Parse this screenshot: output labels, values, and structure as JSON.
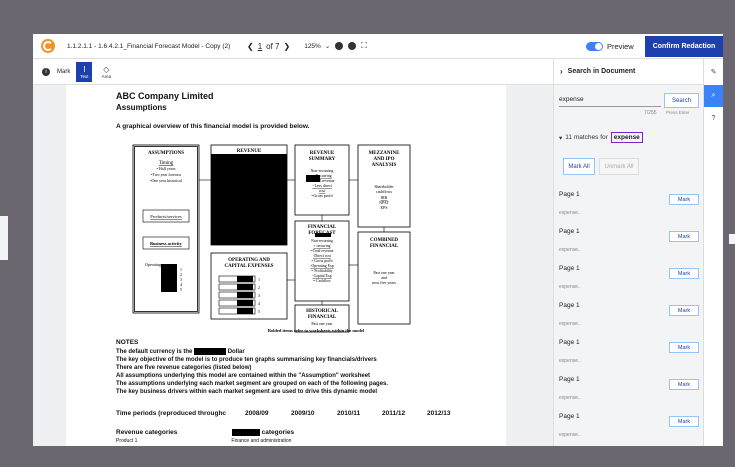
{
  "topbar": {
    "doc_name": "1.1.2.1.1 - 1.6.4.2.1_Financial Forecast Model - Copy (2)",
    "prev": "❮",
    "page_current": "1",
    "page_of": "of 7",
    "next": "❯",
    "zoom": "125%",
    "zoom_caret": "⌄",
    "preview_label": "Preview",
    "confirm_label": "Confirm Redaction"
  },
  "toolbar": {
    "mode_label": "Mark",
    "tool_text": "Text",
    "tool_area": "Area"
  },
  "document": {
    "title": "ABC Company Limited",
    "subtitle": "Assumptions",
    "overview": "A graphical overview of this financial model is provided below.",
    "diagram": {
      "assumptions": "ASSUMPTIONS",
      "a_timing": "Timing",
      "a_half": "• Half years",
      "a_two": "•Two year forecast",
      "a_one": "•One year historical",
      "a_products": "Products/services",
      "a_business": "Business activity",
      "a_operating": "Operating",
      "a_n1": "1",
      "a_n2": "2",
      "a_n3": "3",
      "a_n4": "4",
      "a_n5": "5",
      "revenue": "REVENUE",
      "rs_title1": "REVENUE",
      "rs_title2": "SUMMARY",
      "rs_l1": "Non-recurring",
      "rs_l2": "+ Recurring",
      "rs_l3": "= Total revenue",
      "rs_l4": "- Less direct",
      "rs_l5": "cost",
      "rs_l6": "=Gross profit",
      "mz_title1": "MEZZANINE",
      "mz_title2": "AND IPO",
      "mz_title3": "ANALYSIS",
      "mz_l1": "Shareholder",
      "mz_l2": "cashflows",
      "mz_l3": "IRR",
      "mz_l4": "NPAT",
      "mz_l5": "EPS",
      "ff_title1": "FINANCIAL",
      "ff_title2": "FORECAST",
      "ff_l1": "Non-recurring",
      "ff_l2": "+ recurring",
      "ff_l3": "=Total revenue",
      "ff_l4": "-Direct cost",
      "ff_l5": "= Gross profit",
      "ff_l6": "-Operating Exp",
      "ff_l7": "= Profitability",
      "ff_l8": "-Capital Exp",
      "ff_l9": "= Cashflow",
      "op_title1": "OPERATING AND",
      "op_title2": "CAPITAL EXPENSES",
      "op_n1": "1",
      "op_n2": "2",
      "op_n3": "3",
      "op_n4": "4",
      "op_n5": "5",
      "cf_title1": "COMBINED",
      "cf_title2": "FINANCIAL",
      "cf_l1": "Past one year",
      "cf_l2": "and",
      "cf_l3": "next five years",
      "hf_title1": "HISTORICAL",
      "hf_title2": "FINANCIAL",
      "hf_l1": "Past one year",
      "caption": "Bolded items refer to worksheets within the model"
    },
    "notes_title": "NOTES",
    "note1_a": "The default currency is the",
    "note1_b": "Dollar",
    "note2": "The key objective of the model is to produce ten graphs summarising key financials/drivers",
    "note3": "There are five revenue categories (listed below)",
    "note4": "All assumptions underlying this model are contained within the \"Assumption\" worksheet",
    "note5": "The assumptions underlying each market segment are grouped on each of the following pages.",
    "note6": "The key business drivers within each market segment are used to drive this dynamic model",
    "time_periods_label": "Time periods (reproduced throughc",
    "years": [
      "2008/09",
      "2009/10",
      "2010/11",
      "2011/12",
      "2012/13"
    ],
    "revenue_categories_label": "Revenue categories",
    "categories_label": "categories",
    "product1": "Product 1",
    "finance_admin": "Finance and administration"
  },
  "sidebar": {
    "title": "Search in Document",
    "search_value": "expense",
    "char_count": "7/255",
    "search_button": "Search",
    "press_enter": "Press Enter",
    "matches_label": "11 matches for",
    "matches_term": "expense",
    "mark_all": "Mark All",
    "unmark_all": "Unmark All",
    "results": [
      {
        "page": "Page 1",
        "snippet": "expense..",
        "action": "Mark"
      },
      {
        "page": "Page 1",
        "snippet": "expense..",
        "action": "Mark"
      },
      {
        "page": "Page 1",
        "snippet": "expense..",
        "action": "Mark"
      },
      {
        "page": "Page 1",
        "snippet": "expense..",
        "action": "Mark"
      },
      {
        "page": "Page 1",
        "snippet": "expense..",
        "action": "Mark"
      },
      {
        "page": "Page 1",
        "snippet": "expense..",
        "action": "Mark"
      },
      {
        "page": "Page 1",
        "snippet": "expense..",
        "action": "Mark"
      }
    ]
  },
  "rail": {
    "help": "?"
  },
  "colors": {
    "accent": "#1e40af",
    "toggle": "#3b82f6",
    "term_border": "#7e22ce",
    "logo": "#f0932b"
  }
}
